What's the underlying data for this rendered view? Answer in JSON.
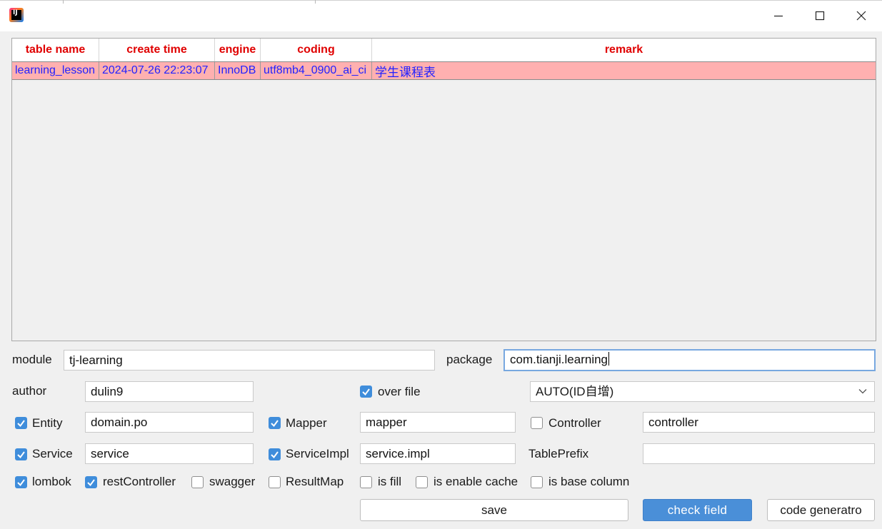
{
  "window": {
    "icon": "intellij-idea-logo-icon",
    "icon_text": "IJ",
    "controls": [
      "minimize-icon",
      "maximize-icon",
      "close-icon"
    ]
  },
  "table": {
    "columns": [
      "table name",
      "create time",
      "engine",
      "coding",
      "remark"
    ],
    "rows": [
      {
        "table_name": "learning_lesson",
        "create_time": "2024-07-26 22:23:07",
        "engine": "InnoDB",
        "coding": "utf8mb4_0900_ai_ci",
        "remark": "学生课程表"
      }
    ],
    "header_color": "#e00000",
    "row_text_color": "#2222ff",
    "selected_row_bg": "#ffb0b0"
  },
  "form": {
    "module": {
      "label": "module",
      "value": "tj-learning"
    },
    "package": {
      "label": "package",
      "value": "com.tianji.learning"
    },
    "author": {
      "label": "author",
      "value": "dulin9"
    },
    "over_file": {
      "label": "over file",
      "checked": true
    },
    "id_type": {
      "value": "AUTO(ID自增)",
      "icon": "chevron-down-icon"
    },
    "entity": {
      "label": "Entity",
      "checked": true,
      "value": "domain.po"
    },
    "mapper": {
      "label": "Mapper",
      "checked": true,
      "value": "mapper"
    },
    "controller": {
      "label": "Controller",
      "checked": false,
      "value": "controller"
    },
    "service": {
      "label": "Service",
      "checked": true,
      "value": "service"
    },
    "service_impl": {
      "label": "ServiceImpl",
      "checked": true,
      "value": "service.impl"
    },
    "table_prefix": {
      "label": "TablePrefix",
      "value": ""
    },
    "options": [
      {
        "key": "lombok",
        "label": "lombok",
        "checked": true
      },
      {
        "key": "rest_controller",
        "label": "restController",
        "checked": true
      },
      {
        "key": "swagger",
        "label": "swagger",
        "checked": false
      },
      {
        "key": "result_map",
        "label": "ResultMap",
        "checked": false
      },
      {
        "key": "is_fill",
        "label": "is fill",
        "checked": false
      },
      {
        "key": "is_enable_cache",
        "label": "is enable cache",
        "checked": false
      },
      {
        "key": "is_base_column",
        "label": "is base column",
        "checked": false
      }
    ]
  },
  "buttons": {
    "save": "save",
    "check_field": "check field",
    "code_generator": "code generatro"
  },
  "colors": {
    "accent": "#4a8fd8",
    "checkbox_on": "#3f8ddb",
    "focus_border": "#78a8e0"
  }
}
